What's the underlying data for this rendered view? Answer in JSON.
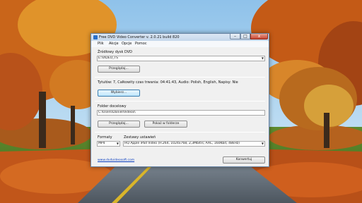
{
  "window": {
    "title": "Free DVD Video Converter  v. 2.0.21 build 820",
    "minimize_glyph": "–",
    "maximize_glyph": "□",
    "close_glyph": "x"
  },
  "menu": [
    "Plik",
    "Akcje",
    "Opcje",
    "Pomoc"
  ],
  "source": {
    "label": "Źródłowy dysk DVD",
    "value": "E:\\VIDEO_TS",
    "browse_label": "Przeglądaj..."
  },
  "info": {
    "text": "Tytułów: 7, Całkowity czas trwania: 04:41:43, Audio: Polish, English, Napisy: Nie",
    "select_label": "Wybierz..."
  },
  "destination": {
    "label": "Folder docelowy",
    "value": "C:\\Users\\Daniel\\Videos\\",
    "browse_label": "Przeglądaj...",
    "open_folder_label": "Pokaż w folderze"
  },
  "formats": {
    "label": "Formaty",
    "value": "MP4"
  },
  "presets": {
    "label": "Zestawy ustawień",
    "value": "HQ Apple iPad Video (H.264, 1024x768, 2,3Mbit/s; AAC, 160Kbit, 48kHz)"
  },
  "footer": {
    "link": "www.dvdvideosoft.com",
    "convert_label": "Konwertuj"
  },
  "colors": {
    "window_bg": "#f0f0f0",
    "link": "#0b3fbf",
    "focus_border": "#3c7fb1"
  }
}
